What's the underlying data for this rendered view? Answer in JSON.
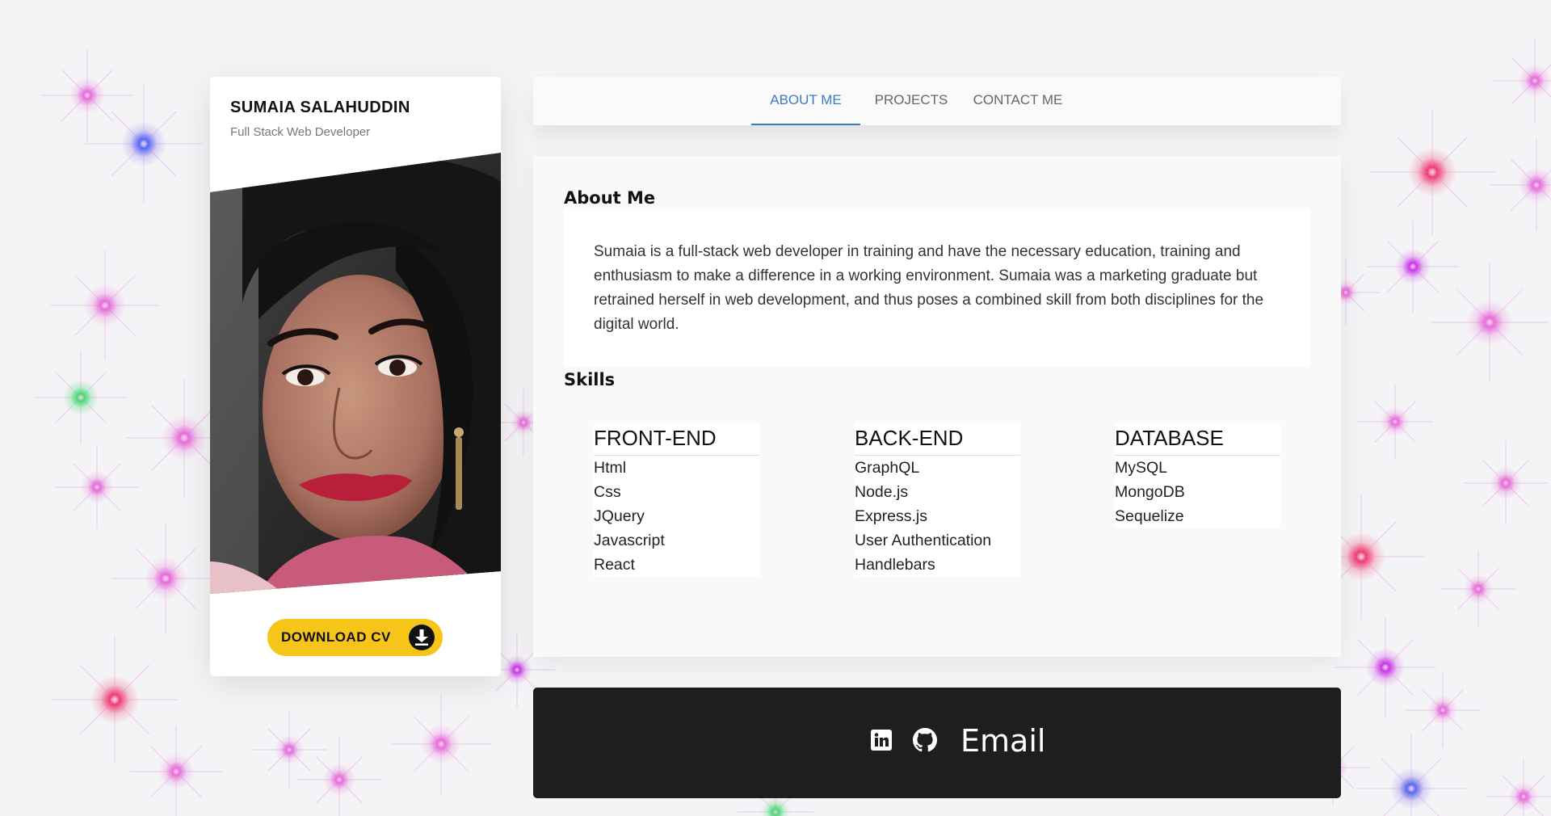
{
  "profile": {
    "name": "SUMAIA SALAHUDDIN",
    "title": "Full Stack Web Developer",
    "download_label": "DOWNLOAD CV"
  },
  "nav": {
    "tabs": [
      {
        "label": "ABOUT ME",
        "active": true
      },
      {
        "label": "PROJECTS",
        "active": false
      },
      {
        "label": "CONTACT ME",
        "active": false
      }
    ]
  },
  "about": {
    "heading": "About Me",
    "body": "Sumaia is a full-stack web developer in training and have the necessary education, training and enthusiasm to make a difference in a working environment. Sumaia was a marketing graduate but retrained herself in web development, and thus poses a combined skill from both disciplines for the digital world."
  },
  "skills": {
    "heading": "Skills",
    "columns": [
      {
        "title": "FRONT-END",
        "items": [
          "Html",
          "Css",
          "JQuery",
          "Javascript",
          "React"
        ]
      },
      {
        "title": "BACK-END",
        "items": [
          "GraphQL",
          "Node.js",
          "Express.js",
          "User Authentication",
          "Handlebars"
        ]
      },
      {
        "title": "DATABASE",
        "items": [
          "MySQL",
          "MongoDB",
          "Sequelize"
        ]
      }
    ]
  },
  "footer": {
    "email_label": "Email",
    "icons": [
      "linkedin-icon",
      "github-icon"
    ]
  },
  "colors": {
    "accent": "#3b7bc4",
    "download_button": "#f7c419",
    "footer_bg": "#1e1e1e",
    "page_bg": "#f4f3f5"
  }
}
